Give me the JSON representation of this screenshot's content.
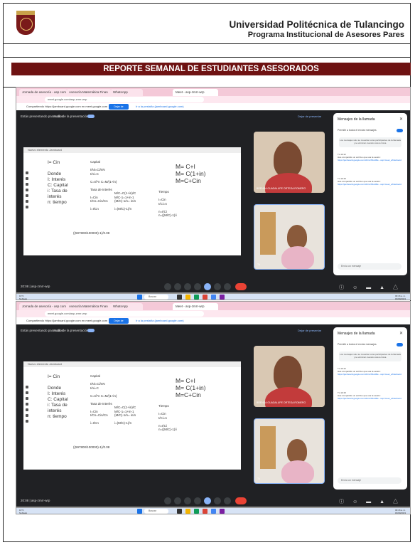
{
  "header": {
    "university": "Universidad Politécnica de Tulancingo",
    "program": "Programa Institucional de Asesores Pares"
  },
  "banner": {
    "title": "REPORTE SEMANAL DE ESTUDIANTES ASESORADOS"
  },
  "colors": {
    "banner": "#6e1212",
    "tabbar": "#f4c9d8",
    "meet_bg": "#202124",
    "accent": "#1a73e8"
  },
  "screenshot": {
    "tabs": [
      "Jornada de asesoría - asp com",
      "Asesoría Matemática Finan",
      "WhatsApp",
      "Meet - asp-zmrr-wrp"
    ],
    "url": "meet.google.com/asp-zmrr-wrp",
    "share_msg": "Compartiendo https://jamboard.google.com en meet.google.com",
    "share_button": "Dejar de compartir",
    "stop_link": "Ir a la pestaña (jamboard.google.com)",
    "present_label": "Estás presentando para todos",
    "audio_label": "Audio de la presentación",
    "stop_present": "Dejar de presentar",
    "slide_app": "Nuevo elemento Jamboard",
    "slide": {
      "col1": [
        "I= Cin",
        "",
        "Donde",
        "I: Interés",
        "C: Capital",
        "i: Tasa de",
        "interés",
        "n: tiempo"
      ],
      "col2": [
        "Capital",
        "",
        "I/Ni=Ci/nN",
        "I/ni=C",
        "",
        "C=I/i*n  C=M/(1+in)",
        "",
        "Tasa de Interés",
        "",
        "I=Cin",
        "I/Cn=Cin/Cn",
        "",
        "i=I/Cn"
      ],
      "col3": [
        "",
        "",
        "",
        "",
        "",
        "",
        "",
        "",
        "M/C=C(1+in)/C",
        "M/C-1=1+in-1",
        "(M/C)-1/n= in/n",
        "",
        "i=(M/C)-1)/n"
      ],
      "col4": [
        "M= C+I",
        "M= C(1+in)",
        "M=C+Cin"
      ],
      "col5": [
        "Tiempo",
        "",
        "I=Cin",
        "I/Ci=n",
        "",
        "n=I/Ci",
        "n=((M/C)-1)/i"
      ],
      "bottom": "((597800/100000)-1)/0.08"
    },
    "cam1_label": "BRENDA GUADALUPE ORTEGA ROMERO",
    "cam2_label": "Tú",
    "chat": {
      "title": "Mensajes de la llamada",
      "allow": "Permitir a todos el enviar mensajes",
      "note": "Los mensajes solo se muestran a las participantes de la llamada y se eliminan cuando ésta termina.",
      "messages": [
        {
          "from": "Tú  10:12",
          "text": "Has compartido un archivo que usa la sesión:",
          "link": "https://jamboard.google.com/d/1mzNbcdRe...usp=meet_whiteboard"
        },
        {
          "from": "Tú  10:15",
          "text": "Has compartido un archivo que usa la sesión:",
          "link": "https://jamboard.google.com/d/1mzNbcdRe...usp=meet_whiteboard"
        }
      ],
      "input": "Envía un mensaje"
    },
    "meeting_code": "20:08  |  asp-zmrr-wrp"
  },
  "taskbar": {
    "weather": "16°C\nNublado",
    "search": "Buscar",
    "time": "09:16 a. m.\n18/09/2023"
  }
}
